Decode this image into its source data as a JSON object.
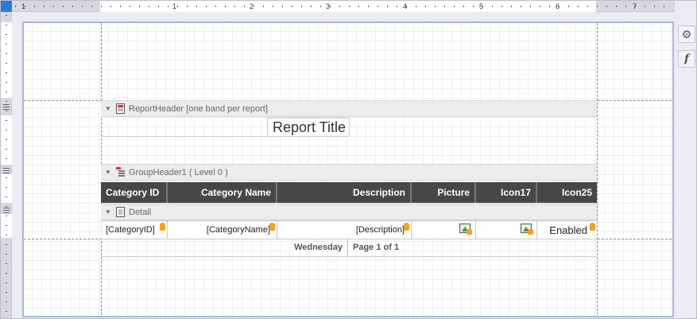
{
  "ruler": {
    "numbers": [
      "1",
      "1",
      "2",
      "3",
      "4",
      "5",
      "6",
      "7"
    ]
  },
  "side_tools": {
    "settings_icon": "gear-icon",
    "function_icon": "function-icon",
    "function_glyph": "f"
  },
  "bands": {
    "report_header": {
      "label": "ReportHeader [one band per report]"
    },
    "group_header": {
      "label": "GroupHeader1 ( Level 0 )"
    },
    "detail": {
      "label": "Detail"
    }
  },
  "report_title": "Report Title",
  "table_header": [
    "Category ID",
    "Category Name",
    "Description",
    "Picture",
    "Icon17",
    "Icon25"
  ],
  "detail_cells": [
    "[CategoryID]",
    "[CategoryName]",
    "[Description]",
    "",
    "",
    "Enabled"
  ],
  "footer": {
    "date": "Wednesday",
    "page": "Page 1 of 1"
  },
  "colors": {
    "accent": "#2d7bd6",
    "header_bg": "#474747",
    "db_icon": "#f3a024"
  }
}
